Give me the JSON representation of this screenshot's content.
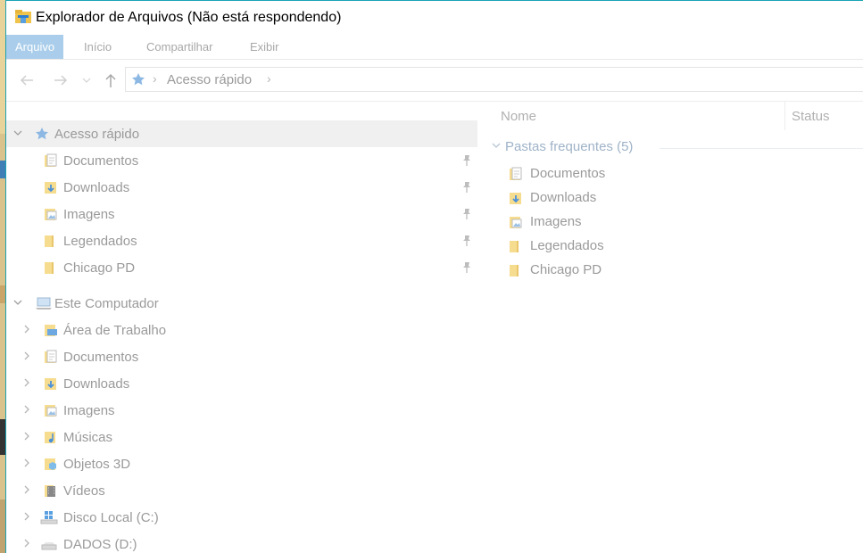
{
  "window": {
    "title": "Explorador de Arquivos (Não está respondendo)"
  },
  "ribbon": {
    "tabs": [
      {
        "label": "Arquivo",
        "active": true
      },
      {
        "label": "Início",
        "active": false
      },
      {
        "label": "Compartilhar",
        "active": false
      },
      {
        "label": "Exibir",
        "active": false
      }
    ]
  },
  "navigation": {
    "back_icon": "back-arrow-icon",
    "forward_icon": "forward-arrow-icon",
    "recent_icon": "chevron-down-icon",
    "up_icon": "up-arrow-icon",
    "address_crumb": "Acesso rápido"
  },
  "tree": {
    "quick_access": {
      "label": "Acesso rápido",
      "items": [
        {
          "label": "Documentos",
          "icon": "documents-icon"
        },
        {
          "label": "Downloads",
          "icon": "downloads-icon"
        },
        {
          "label": "Imagens",
          "icon": "pictures-icon"
        },
        {
          "label": "Legendados",
          "icon": "folder-icon"
        },
        {
          "label": "Chicago PD",
          "icon": "folder-icon"
        }
      ]
    },
    "this_pc": {
      "label": "Este Computador",
      "items": [
        {
          "label": "Área de Trabalho",
          "icon": "desktop-icon"
        },
        {
          "label": "Documentos",
          "icon": "documents-icon"
        },
        {
          "label": "Downloads",
          "icon": "downloads-icon"
        },
        {
          "label": "Imagens",
          "icon": "pictures-icon"
        },
        {
          "label": "Músicas",
          "icon": "music-icon"
        },
        {
          "label": "Objetos 3D",
          "icon": "objects-3d-icon"
        },
        {
          "label": "Vídeos",
          "icon": "videos-icon"
        },
        {
          "label": "Disco Local (C:)",
          "icon": "windows-drive-icon"
        },
        {
          "label": "DADOS (D:)",
          "icon": "drive-icon"
        }
      ]
    }
  },
  "content": {
    "columns": [
      "Nome",
      "Status"
    ],
    "group_label": "Pastas frequentes (5)",
    "items": [
      {
        "label": "Documentos",
        "icon": "documents-icon"
      },
      {
        "label": "Downloads",
        "icon": "downloads-icon"
      },
      {
        "label": "Imagens",
        "icon": "pictures-icon"
      },
      {
        "label": "Legendados",
        "icon": "folder-icon"
      },
      {
        "label": "Chicago PD",
        "icon": "folder-icon"
      }
    ]
  },
  "colors": {
    "active_tab": "#a9cdea",
    "folder": "#f6dc8f",
    "text_dim": "#9a9a9a",
    "window_border": "#1aa3b5"
  }
}
